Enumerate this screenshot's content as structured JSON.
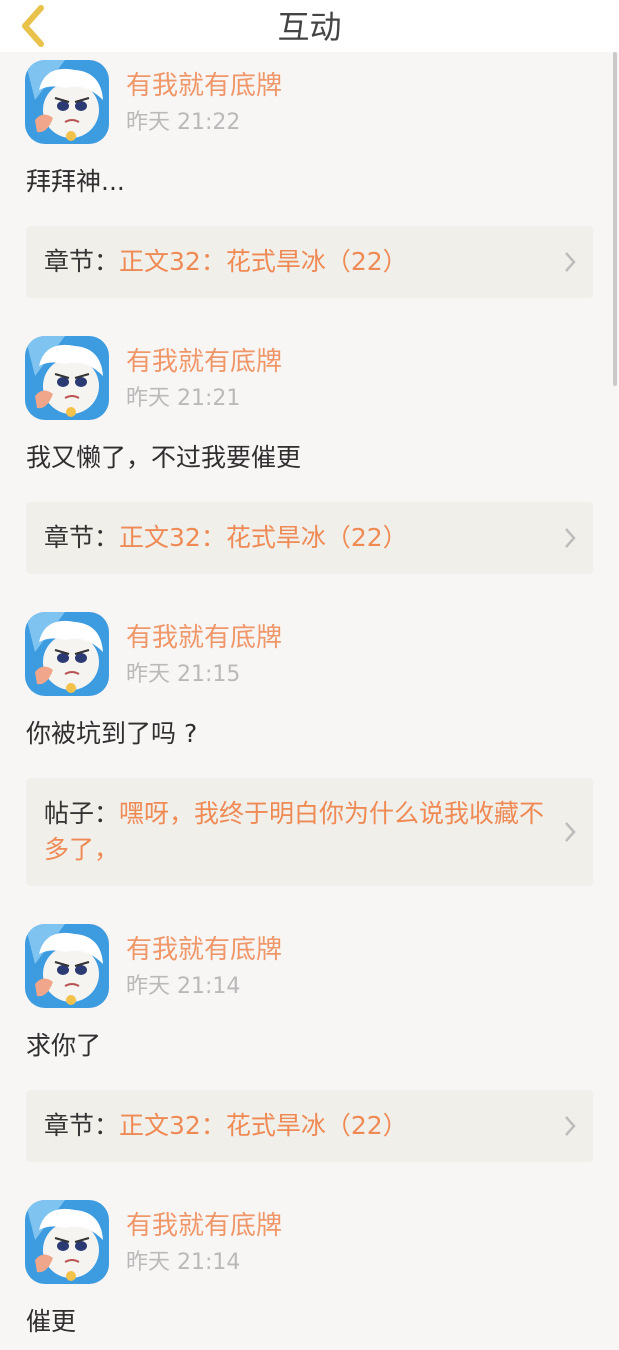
{
  "header": {
    "title": "互动",
    "back_icon": "chevron-left-icon",
    "back_color": "#e8c24a"
  },
  "colors": {
    "accent": "#ef8a55",
    "ref_bg": "#f1efea",
    "time": "#b9b9b9"
  },
  "items": [
    {
      "username": "有我就有底牌",
      "time": "昨天 21:22",
      "content": "拜拜神...",
      "ref_label": "章节：",
      "ref_value": "正文32：花式旱冰（22）"
    },
    {
      "username": "有我就有底牌",
      "time": "昨天 21:21",
      "content": "我又懒了，不过我要催更",
      "ref_label": "章节：",
      "ref_value": "正文32：花式旱冰（22）"
    },
    {
      "username": "有我就有底牌",
      "time": "昨天 21:15",
      "content": "你被坑到了吗 ?",
      "ref_label": "帖子：",
      "ref_value": "嘿呀，我终于明白你为什么说我收藏不多了，"
    },
    {
      "username": "有我就有底牌",
      "time": "昨天 21:14",
      "content": "求你了",
      "ref_label": "章节：",
      "ref_value": "正文32：花式旱冰（22）"
    },
    {
      "username": "有我就有底牌",
      "time": "昨天 21:14",
      "content": "催更"
    }
  ]
}
